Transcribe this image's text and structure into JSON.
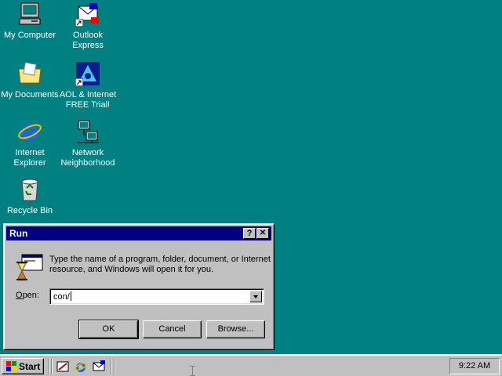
{
  "desktop": {
    "icons": [
      {
        "name": "my-computer-icon",
        "label": "My Computer"
      },
      {
        "name": "outlook-express-icon",
        "label": "Outlook\nExpress"
      },
      {
        "name": "my-documents-icon",
        "label": "My Documents"
      },
      {
        "name": "aol-icon",
        "label": "AOL & Internet\nFREE Trial!"
      },
      {
        "name": "internet-explorer-icon",
        "label": "Internet\nExplorer"
      },
      {
        "name": "network-neighborhood-icon",
        "label": "Network\nNeighborhood"
      },
      {
        "name": "recycle-bin-icon",
        "label": "Recycle Bin"
      }
    ]
  },
  "run_dialog": {
    "title": "Run",
    "help_label": "?",
    "close_label": "✕",
    "description": "Type the name of a program, folder, document, or Internet resource, and Windows will open it for you.",
    "open_label_prefix": "O",
    "open_label_rest": "pen:",
    "open_value": "con/",
    "ok_label": "OK",
    "cancel_label": "Cancel",
    "browse_label": "Browse..."
  },
  "taskbar": {
    "start_label": "Start",
    "clock": "9:22 AM"
  },
  "colors": {
    "desktop": "#008080",
    "titlebar": "#000080",
    "face": "#c0c0c0"
  }
}
